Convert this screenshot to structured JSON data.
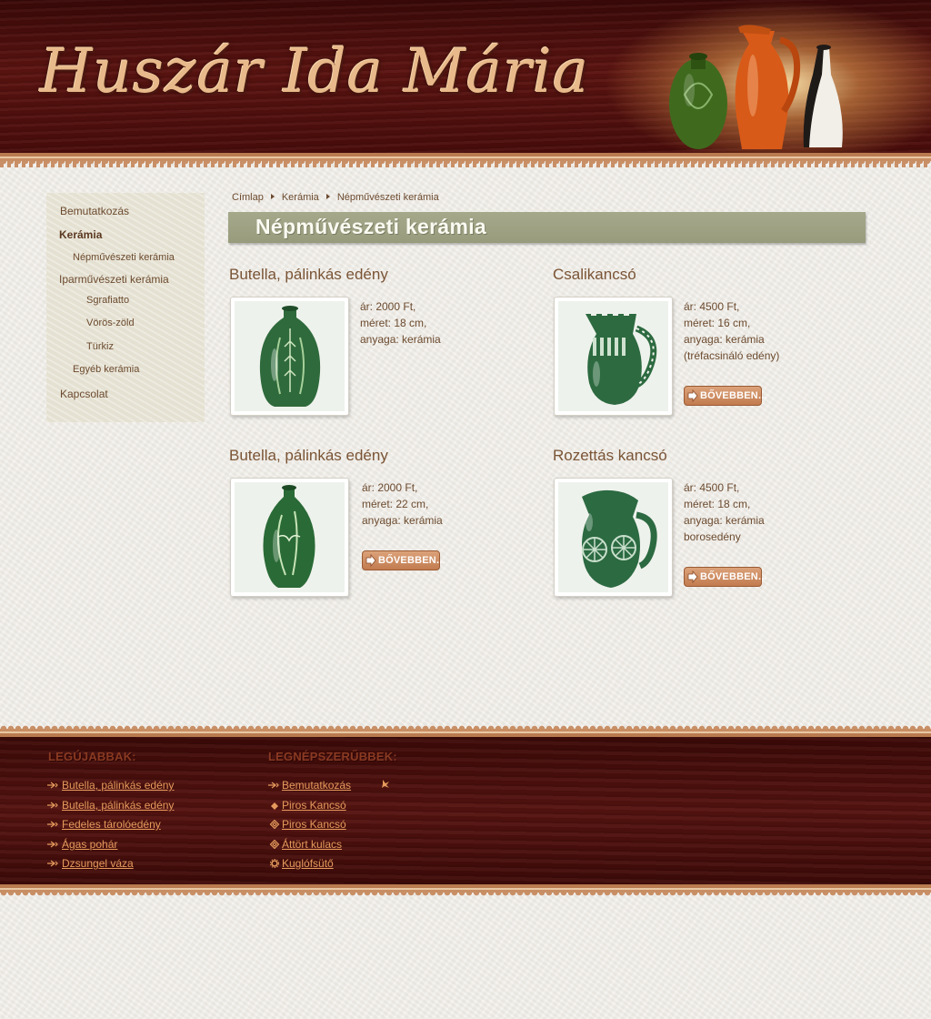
{
  "header": {
    "logo_text": "Huszár Ida Mária"
  },
  "sidebar": {
    "items": [
      {
        "label": "Bemutatkozás"
      },
      {
        "label": "Kerámia"
      },
      {
        "label": "Népművészeti kerámia"
      },
      {
        "label": "Iparművészeti kerámia"
      },
      {
        "label": "Sgrafiatto"
      },
      {
        "label": "Vörös-zöld"
      },
      {
        "label": "Türkiz"
      },
      {
        "label": "Egyéb kerámia"
      },
      {
        "label": "Kapcsolat"
      }
    ]
  },
  "breadcrumb": {
    "items": [
      "Címlap",
      "Kerámia",
      "Népművészeti kerámia"
    ]
  },
  "page": {
    "title": "Népművészeti kerámia"
  },
  "products": [
    {
      "title": "Butella, pálinkás edény",
      "lines": [
        "ár: 2000 Ft,",
        "méret: 18 cm,",
        "anyaga: kerámia"
      ],
      "has_more": false
    },
    {
      "title": "Csalikancsó",
      "lines": [
        "ár: 4500 Ft,",
        "méret: 16 cm,",
        "anyaga: kerámia",
        "(tréfacsináló edény)"
      ],
      "has_more": true
    },
    {
      "title": "Butella, pálinkás edény",
      "lines": [
        "ár: 2000 Ft,",
        "méret: 22 cm,",
        "anyaga: kerámia"
      ],
      "has_more": true
    },
    {
      "title": "Rozettás kancsó",
      "lines": [
        "ár: 4500 Ft,",
        "méret: 18 cm,",
        "anyaga: kerámia",
        "borosedény"
      ],
      "has_more": true
    }
  ],
  "more_button_label": "BŐVEBBEN...",
  "footer": {
    "newest": {
      "heading": "LEGÚJABBAK:",
      "links": [
        "Butella, pálinkás edény",
        "Butella, pálinkás edény",
        "Fedeles tárolóedény",
        "Ágas pohár",
        "Dzsungel váza"
      ]
    },
    "popular": {
      "heading": "LEGNÉPSZERŰBBEK:",
      "links": [
        "Bemutatkozás",
        "Piros Kancsó",
        "Piros Kancsó",
        "Áttört kulacs",
        "Kuglófsütő"
      ]
    }
  },
  "colors": {
    "header_wood": "#4a0d0b",
    "title_bar": "#9a9e80",
    "text_brown": "#6b4a2e",
    "footer_link": "#e59a5c",
    "button": "#c98a5e"
  }
}
